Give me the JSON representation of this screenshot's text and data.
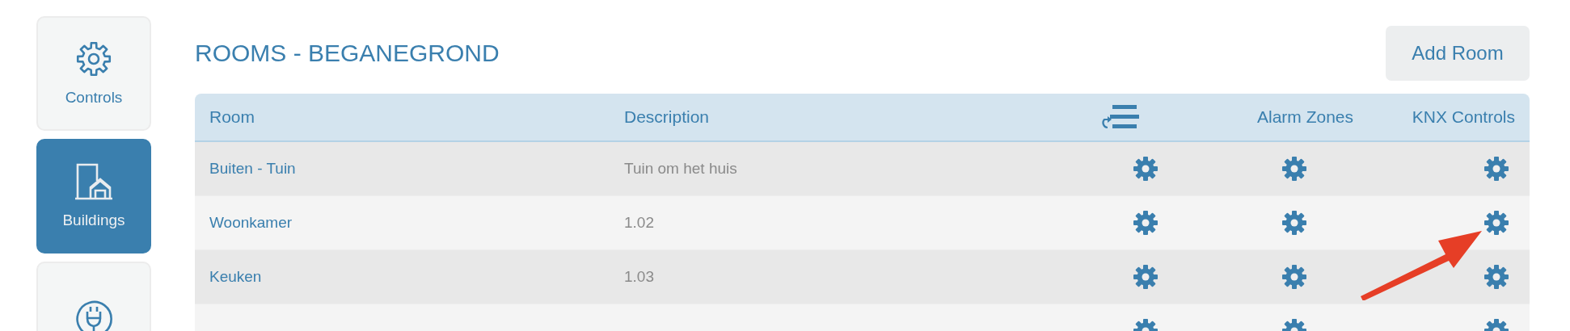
{
  "sidebar": {
    "items": [
      {
        "kind": "gear",
        "label": "Controls",
        "selected": false
      },
      {
        "kind": "building",
        "label": "Buildings",
        "selected": true
      },
      {
        "kind": "plug",
        "selected": false
      }
    ]
  },
  "page": {
    "title": "ROOMS - BEGANEGROND",
    "add_button": "Add Room"
  },
  "table": {
    "columns": [
      {
        "kind": "text",
        "label": "Room"
      },
      {
        "kind": "text",
        "label": "Description"
      },
      {
        "kind": "icon"
      },
      {
        "kind": "text",
        "label": "Alarm Zones"
      },
      {
        "kind": "text",
        "label": "KNX Controls"
      }
    ],
    "rows": [
      {
        "room": "Buiten - Tuin",
        "description": "Tuin om het huis"
      },
      {
        "room": "Woonkamer",
        "description": "1.02"
      },
      {
        "room": "Keuken",
        "description": "1.03"
      },
      {}
    ]
  },
  "annotations": [
    {
      "kind": "arrow"
    }
  ]
}
